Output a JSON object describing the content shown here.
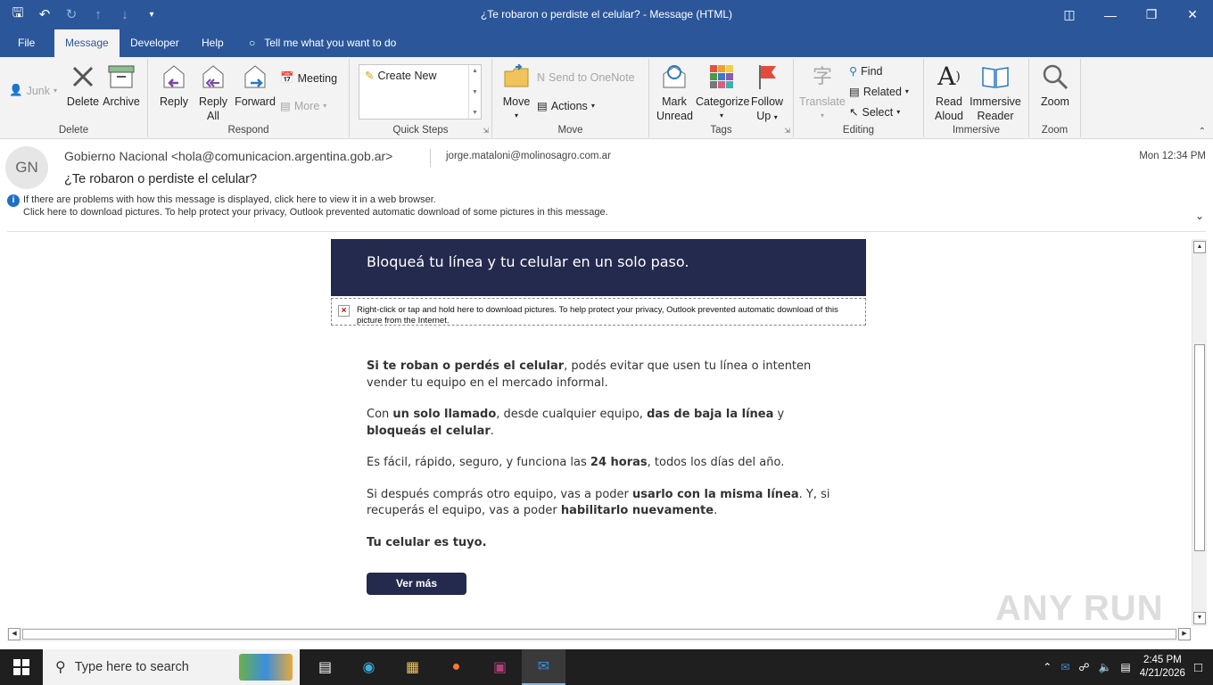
{
  "window": {
    "title": "¿Te robaron o perdiste el celular?  -  Message (HTML)"
  },
  "tabs": [
    "File",
    "Message",
    "Developer",
    "Help"
  ],
  "tell_me": "Tell me what you want to do",
  "ribbon": {
    "delete_group": {
      "label": "Delete",
      "junk": "Junk",
      "delete": "Delete",
      "archive": "Archive"
    },
    "respond_group": {
      "label": "Respond",
      "reply": "Reply",
      "reply_all_1": "Reply",
      "reply_all_2": "All",
      "forward": "Forward",
      "meeting": "Meeting",
      "more": "More"
    },
    "quick_steps": {
      "label": "Quick Steps",
      "create_new": "Create New"
    },
    "move_group": {
      "label": "Move",
      "move": "Move",
      "send_onenote": "Send to OneNote",
      "actions": "Actions"
    },
    "tags_group": {
      "label": "Tags",
      "mark_unread_1": "Mark",
      "mark_unread_2": "Unread",
      "categorize": "Categorize",
      "follow_up_1": "Follow",
      "follow_up_2": "Up"
    },
    "editing_group": {
      "label": "Editing",
      "translate": "Translate",
      "find": "Find",
      "related": "Related",
      "select": "Select"
    },
    "immersive_group": {
      "label": "Immersive",
      "read_aloud_1": "Read",
      "read_aloud_2": "Aloud",
      "immersive_reader_1": "Immersive",
      "immersive_reader_2": "Reader"
    },
    "zoom_group": {
      "label": "Zoom",
      "zoom": "Zoom"
    }
  },
  "message": {
    "avatar_initials": "GN",
    "from": "Gobierno Nacional <hola@comunicacion.argentina.gob.ar>",
    "to": "jorge.mataloni@molinosagro.com.ar",
    "date": "Mon 12:34 PM",
    "subject": "¿Te robaron o perdiste el celular?",
    "info_line_1": "If there are problems with how this message is displayed, click here to view it in a web browser.",
    "info_line_2": "Click here to download pictures. To help protect your privacy, Outlook prevented automatic download of some pictures in this message."
  },
  "email": {
    "banner": "Bloqueá tu línea y tu celular en un solo paso.",
    "blocked_image": "Right-click or tap and hold here to download pictures. To help protect your privacy, Outlook prevented automatic download of this picture from the Internet.",
    "p1_b": "Si te roban o perdés el celular",
    "p1_rest": ", podés evitar que usen tu línea o intenten vender tu equipo en el mercado informal.",
    "p2_a": "Con ",
    "p2_b1": "un solo llamado",
    "p2_c": ", desde cualquier equipo, ",
    "p2_b2": "das de baja la línea",
    "p2_d": " y ",
    "p2_b3": "bloqueás el celular",
    "p2_e": ".",
    "p3_a": "Es fácil, rápido, seguro, y funciona las ",
    "p3_b": "24 horas",
    "p3_c": ", todos los días del año.",
    "p4_a": "Si después comprás otro equipo, vas a poder ",
    "p4_b1": "usarlo con la misma línea",
    "p4_c": ". Y, si recuperás el equipo, vas a poder ",
    "p4_b2": "habilitarlo nuevamente",
    "p4_d": ".",
    "p5": "Tu celular es tuyo.",
    "button": "Ver más"
  },
  "watermark": "ANY RUN",
  "taskbar": {
    "search_placeholder": "Type here to search",
    "time": "2:45 PM",
    "date": "4/21/2026"
  }
}
